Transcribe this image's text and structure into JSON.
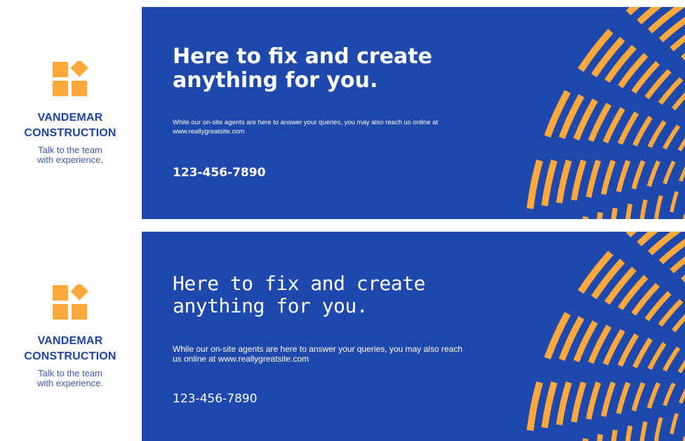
{
  "brand_color": "#1f48ad",
  "accent_color": "#ffa83b",
  "variants": [
    {
      "company_line1": "VANDEMAR",
      "company_line2": "CONSTRUCTION",
      "tagline_line1": "Talk to the team",
      "tagline_line2": "with experience.",
      "headline_line1": "Here to fix and create",
      "headline_line2": "anything for you.",
      "body": "While our on-site agents are here to answer your queries, you may also reach us online at www.reallygreatsite.com",
      "phone": "123-456-7890"
    },
    {
      "company_line1": "VANDEMAR",
      "company_line2": "CONSTRUCTION",
      "tagline_line1": "Talk to the team",
      "tagline_line2": "with experience.",
      "headline_line1": "Here to fix and create",
      "headline_line2": "anything for you.",
      "body": "While our on-site agents are here to answer your queries, you may also reach us online at www.reallygreatsite.com",
      "phone": "123-456-7890"
    }
  ],
  "logo_icon": "blocks-logo-icon",
  "decoration_icon": "arc-stripes-pattern"
}
